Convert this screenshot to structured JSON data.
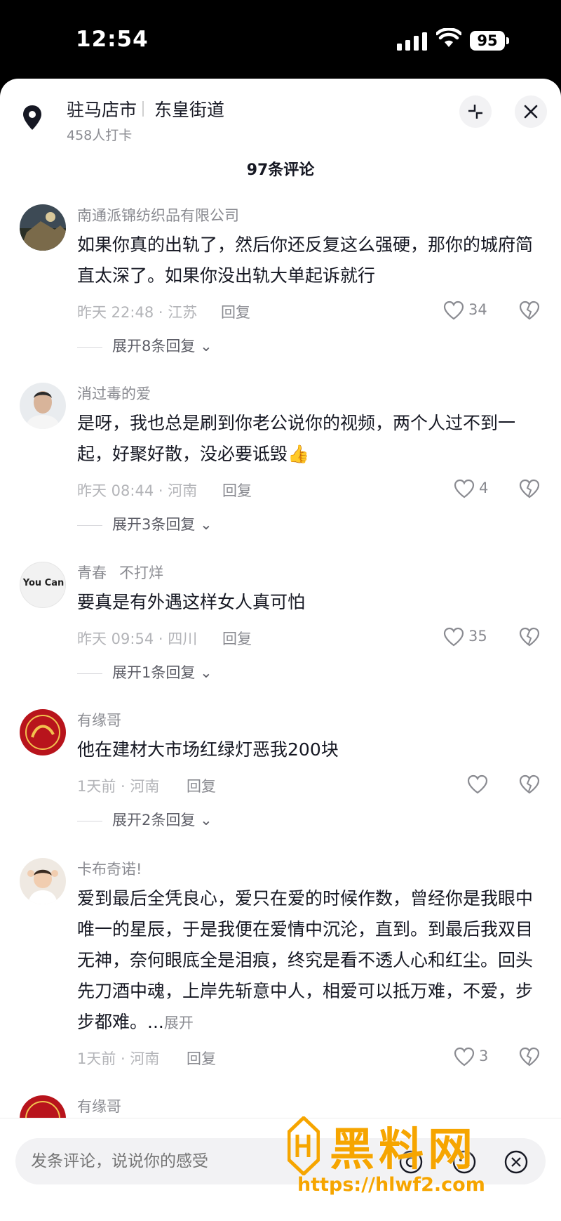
{
  "status_bar": {
    "time": "12:54",
    "battery": "95"
  },
  "header": {
    "location_name": "驻马店市",
    "location_street": "东皇街道",
    "checkins": "458人打卡",
    "comment_count": "97条评论"
  },
  "comments": [
    {
      "username": "南通派锦纺织品有限公司",
      "text": "如果你真的出轨了，然后你还反复这么强硬，那你的城府简直太深了。如果你没出轨大单起诉就行",
      "meta": "昨天 22:48 · 江苏",
      "reply_label": "回复",
      "likes": "34",
      "replies": "展开8条回复"
    },
    {
      "username": "消过毒的爱",
      "text": "是呀，我也总是刷到你老公说你的视频，两个人过不到一起，好聚好散，没必要诋毁👍",
      "meta": "昨天 08:44 · 河南",
      "reply_label": "回复",
      "likes": "4",
      "replies": "展开3条回复"
    },
    {
      "username": "青春",
      "username_extra": "不打烊",
      "avatar_text": "You Can",
      "text": "要真是有外遇这样女人真可怕",
      "meta": "昨天 09:54 · 四川",
      "reply_label": "回复",
      "likes": "35",
      "replies": "展开1条回复"
    },
    {
      "username": "有缘哥",
      "text": "他在建材大市场红绿灯恶我200块",
      "meta": "1天前 · 河南",
      "reply_label": "回复",
      "likes": "",
      "replies": "展开2条回复"
    },
    {
      "username": "卡布奇诺!",
      "text": "爱到最后全凭良心，爱只在爱的时候作数，曾经你是我眼中唯一的星辰，于是我便在爱情中沉沦，直到。到最后我双目无神，奈何眼底全是泪痕，终究是看不透人心和红尘。回头先刀酒中魂，上岸先斩意中人，相爱可以抵万难，不爱，步步都难。...",
      "expand_label": "展开",
      "meta": "1天前 · 河南",
      "reply_label": "回复",
      "likes": "3"
    },
    {
      "username": "有缘哥"
    }
  ],
  "bottom_bar": {
    "placeholder": "发条评论，说说你的感受"
  },
  "watermark": {
    "title": "黑料网",
    "url": "https://hlwf2.com"
  },
  "icons": {
    "location": "location-pin-icon",
    "collapse": "collapse-icon",
    "close": "close-icon",
    "like": "heart-icon",
    "dislike": "broken-heart-icon",
    "mention": "at-icon",
    "emoji": "emoji-icon",
    "image": "image-icon"
  },
  "colors": {
    "text": "#161823",
    "muted": "#8a8b91",
    "watermark": "#f6a500"
  }
}
